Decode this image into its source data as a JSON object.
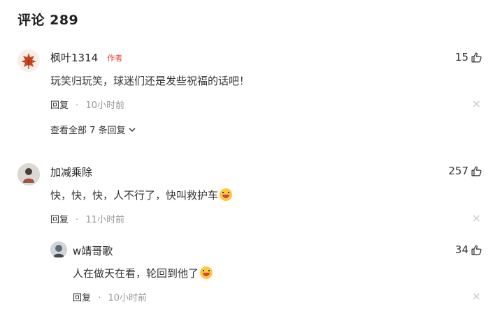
{
  "header": {
    "title": "评论 289"
  },
  "comments": [
    {
      "username": "枫叶1314",
      "author_tag": "作者",
      "text": "玩笑归玩笑，球迷们还是发些祝福的话吧！",
      "reply_label": "回复",
      "time": "10小时前",
      "likes": "15",
      "expand_label": "查看全部 7 条回复"
    },
    {
      "username": "加减乘除",
      "text": "快，快，快，人不行了，快叫救护车",
      "reply_label": "回复",
      "time": "11小时前",
      "likes": "257",
      "replies": [
        {
          "username": "w靖哥歌",
          "text": "人在做天在看，轮回到他了",
          "reply_label": "回复",
          "time": "10小时前",
          "likes": "34"
        }
      ]
    }
  ],
  "icons": {
    "like": "thumbs-up-icon",
    "close": "close-icon",
    "expand": "chevron-down-icon",
    "emoji": "laughing-emoji-icon"
  },
  "colors": {
    "author_tag": "#e8423a",
    "meta": "#999999"
  },
  "dot_separator": "·",
  "close_glyph": "×"
}
